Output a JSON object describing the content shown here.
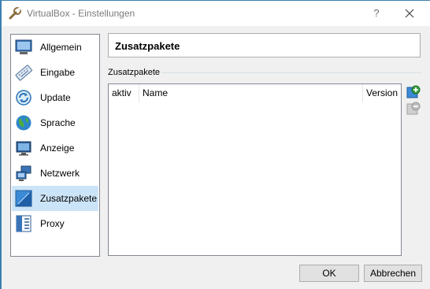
{
  "window": {
    "title": "VirtualBox - Einstellungen",
    "help_glyph": "?"
  },
  "sidebar": {
    "items": [
      {
        "label": "Allgemein",
        "icon": "monitor-icon"
      },
      {
        "label": "Eingabe",
        "icon": "keyboard-icon"
      },
      {
        "label": "Update",
        "icon": "update-icon"
      },
      {
        "label": "Sprache",
        "icon": "globe-icon"
      },
      {
        "label": "Anzeige",
        "icon": "display-icon"
      },
      {
        "label": "Netzwerk",
        "icon": "network-icon"
      },
      {
        "label": "Zusatzpakete",
        "icon": "package-icon",
        "selected": true
      },
      {
        "label": "Proxy",
        "icon": "proxy-icon"
      }
    ]
  },
  "page": {
    "header": "Zusatzpakete",
    "group_title": "Zusatzpakete",
    "table": {
      "columns": [
        "aktiv",
        "Name",
        "Version"
      ],
      "rows": []
    }
  },
  "buttons": {
    "ok": "OK",
    "cancel": "Abbrechen"
  },
  "colors": {
    "selection": "#cce4f7",
    "window_border": "#3c7fb1",
    "add_green": "#2f9e3a"
  }
}
